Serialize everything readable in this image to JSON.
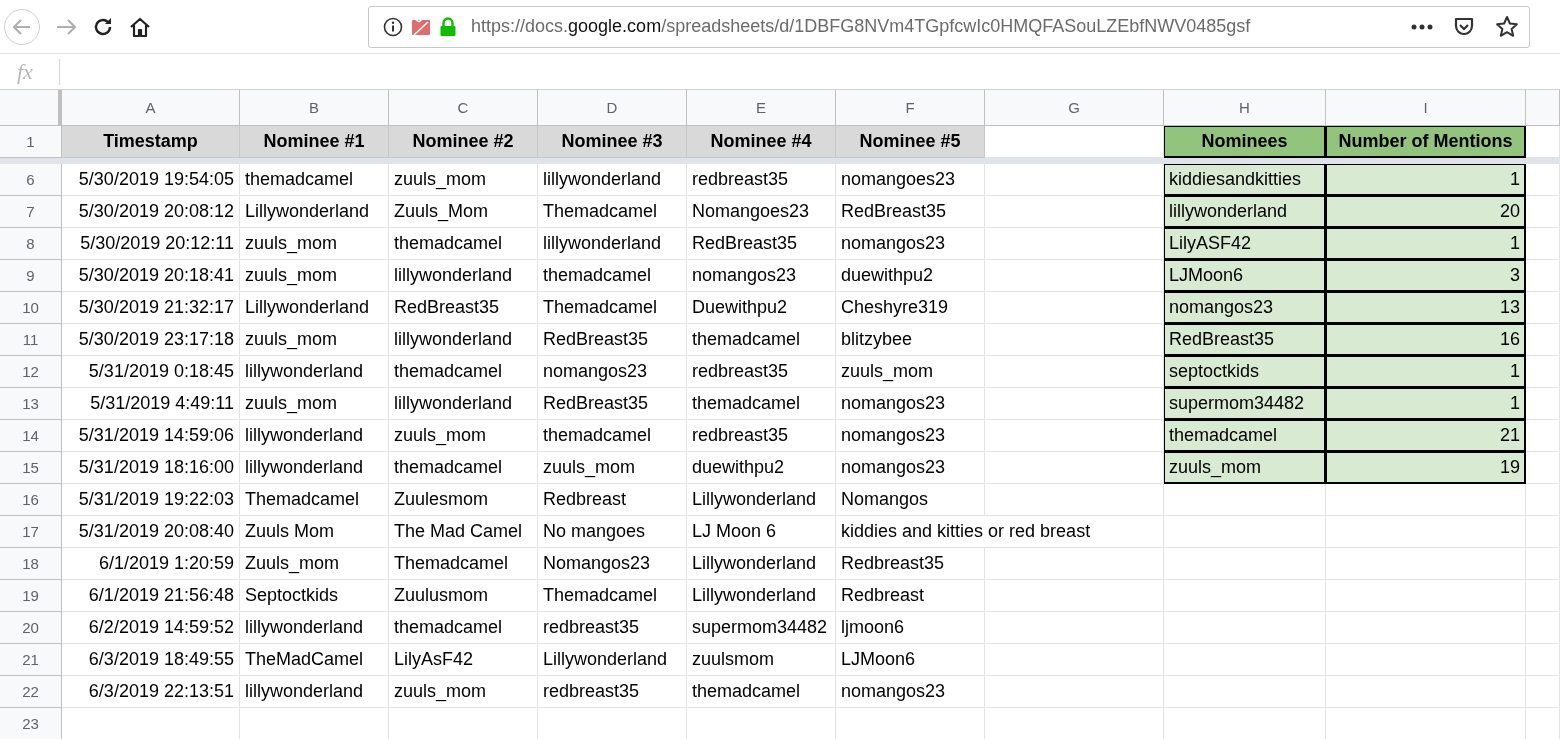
{
  "browser": {
    "url": {
      "scheme": "https://docs.",
      "host": "google.com",
      "path": "/spreadsheets/d/1DBFG8NVm4TGpfcwIc0HMQFASouLZEbfNWV0485gsf"
    }
  },
  "formula_bar": {
    "label": "fx"
  },
  "sheet": {
    "columns": [
      "A",
      "B",
      "C",
      "D",
      "E",
      "F",
      "G",
      "H",
      "I"
    ],
    "header_row": {
      "number": "1",
      "cells": [
        "Timestamp",
        "Nominee #1",
        "Nominee #2",
        "Nominee #3",
        "Nominee #4",
        "Nominee #5"
      ],
      "summary": [
        "Nominees",
        "Number of Mentions"
      ]
    },
    "rows": [
      {
        "number": "6",
        "cells": [
          "5/30/2019 19:54:05",
          "themadcamel",
          "zuuls_mom",
          "lillywonderland",
          "redbreast35",
          "nomangoes23"
        ],
        "summary": [
          "kiddiesandkitties",
          "1"
        ]
      },
      {
        "number": "7",
        "cells": [
          "5/30/2019 20:08:12",
          "Lillywonderland",
          "Zuuls_Mom",
          "Themadcamel",
          "Nomangoes23",
          "RedBreast35"
        ],
        "summary": [
          "lillywonderland",
          "20"
        ]
      },
      {
        "number": "8",
        "cells": [
          "5/30/2019 20:12:11",
          "zuuls_mom",
          "themadcamel",
          "lillywonderland",
          "RedBreast35",
          "nomangos23"
        ],
        "summary": [
          "LilyASF42",
          "1"
        ]
      },
      {
        "number": "9",
        "cells": [
          "5/30/2019 20:18:41",
          "zuuls_mom",
          "lillywonderland",
          "themadcamel",
          "nomangos23",
          "duewithpu2"
        ],
        "summary": [
          "LJMoon6",
          "3"
        ]
      },
      {
        "number": "10",
        "cells": [
          "5/30/2019 21:32:17",
          "Lillywonderland",
          "RedBreast35",
          "Themadcamel",
          "Duewithpu2",
          "Cheshyre319"
        ],
        "summary": [
          "nomangos23",
          "13"
        ]
      },
      {
        "number": "11",
        "cells": [
          "5/30/2019 23:17:18",
          "zuuls_mom",
          "lillywonderland",
          "RedBreast35",
          "themadcamel",
          "blitzybee"
        ],
        "summary": [
          "RedBreast35",
          "16"
        ]
      },
      {
        "number": "12",
        "cells": [
          "5/31/2019 0:18:45",
          "lillywonderland",
          "themadcamel",
          "nomangos23",
          "redbreast35",
          "zuuls_mom"
        ],
        "summary": [
          "septoctkids",
          "1"
        ]
      },
      {
        "number": "13",
        "cells": [
          "5/31/2019 4:49:11",
          "zuuls_mom",
          "lillywonderland",
          "RedBreast35",
          "themadcamel",
          "nomangos23"
        ],
        "summary": [
          "supermom34482",
          "1"
        ]
      },
      {
        "number": "14",
        "cells": [
          "5/31/2019 14:59:06",
          "lillywonderland",
          "zuuls_mom",
          "themadcamel",
          "redbreast35",
          "nomangos23"
        ],
        "summary": [
          "themadcamel",
          "21"
        ]
      },
      {
        "number": "15",
        "cells": [
          "5/31/2019 18:16:00",
          "lillywonderland",
          "themadcamel",
          "zuuls_mom",
          "duewithpu2",
          "nomangos23"
        ],
        "summary": [
          "zuuls_mom",
          "19"
        ]
      },
      {
        "number": "16",
        "cells": [
          "5/31/2019 19:22:03",
          "Themadcamel",
          "Zuulesmom",
          "Redbreast",
          "Lillywonderland",
          "Nomangos"
        ]
      },
      {
        "number": "17",
        "cells": [
          "5/31/2019 20:08:40",
          "Zuuls Mom",
          "The Mad Camel",
          "No mangoes",
          "LJ Moon 6",
          "kiddies and kitties or red breast"
        ]
      },
      {
        "number": "18",
        "cells": [
          "6/1/2019 1:20:59",
          "Zuuls_mom",
          "Themadcamel",
          "Nomangos23",
          "Lillywonderland",
          "Redbreast35"
        ]
      },
      {
        "number": "19",
        "cells": [
          "6/1/2019 21:56:48",
          "Septoctkids",
          "Zuulusmom",
          "Themadcamel",
          "Lillywonderland",
          "Redbreast"
        ]
      },
      {
        "number": "20",
        "cells": [
          "6/2/2019 14:59:52",
          "lillywonderland",
          "themadcamel",
          "redbreast35",
          "supermom34482",
          "ljmoon6"
        ]
      },
      {
        "number": "21",
        "cells": [
          "6/3/2019 18:49:55",
          "TheMadCamel",
          "LilyAsF42",
          "Lillywonderland",
          "zuulsmom",
          "LJMoon6"
        ]
      },
      {
        "number": "22",
        "cells": [
          "6/3/2019 22:13:51",
          "lillywonderland",
          "zuuls_mom",
          "redbreast35",
          "themadcamel",
          "nomangos23"
        ]
      },
      {
        "number": "23"
      }
    ]
  }
}
